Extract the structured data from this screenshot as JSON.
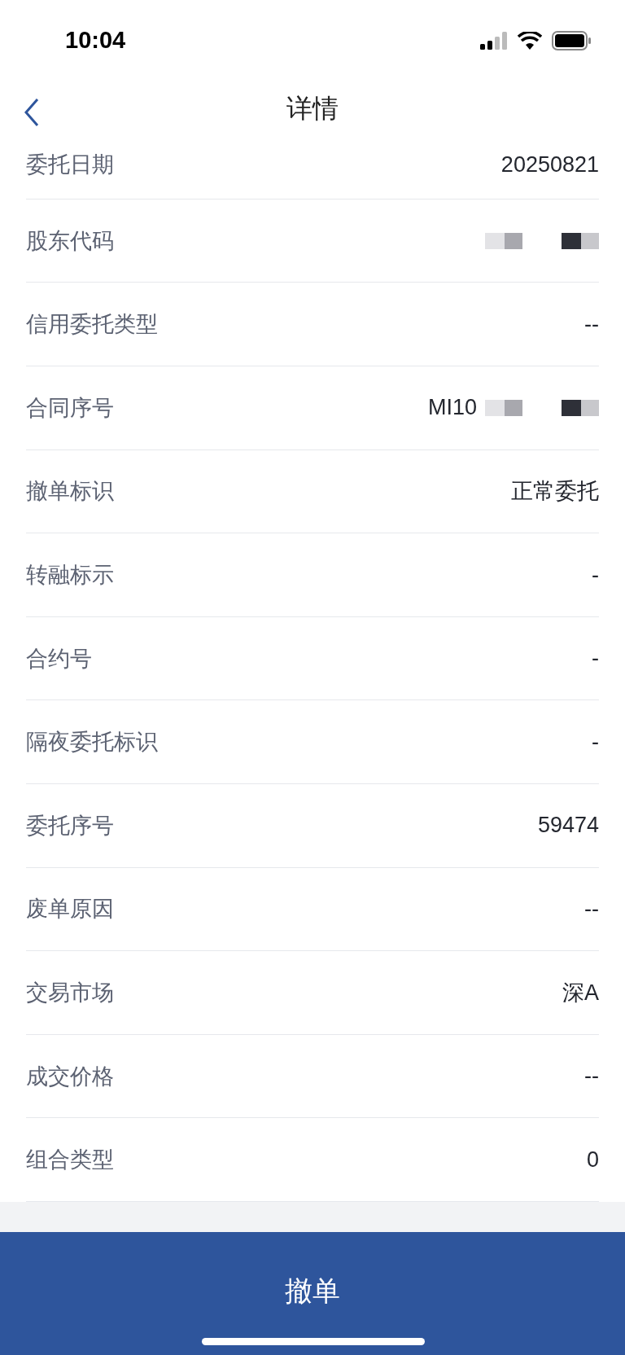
{
  "status_bar": {
    "time": "10:04"
  },
  "nav": {
    "title": "详情"
  },
  "rows": [
    {
      "label": "委托日期",
      "value": "20250821",
      "masked": false
    },
    {
      "label": "股东代码",
      "masked": true
    },
    {
      "label": "信用委托类型",
      "value": "--",
      "masked": false
    },
    {
      "label": "合同序号",
      "value": "MI10",
      "masked": true
    },
    {
      "label": "撤单标识",
      "value": "正常委托",
      "masked": false
    },
    {
      "label": "转融标示",
      "value": "-",
      "masked": false
    },
    {
      "label": "合约号",
      "value": "-",
      "masked": false
    },
    {
      "label": "隔夜委托标识",
      "value": "-",
      "masked": false
    },
    {
      "label": "委托序号",
      "value": "59474",
      "masked": false
    },
    {
      "label": "废单原因",
      "value": "--",
      "masked": false
    },
    {
      "label": "交易市场",
      "value": "深A",
      "masked": false
    },
    {
      "label": "成交价格",
      "value": "--",
      "masked": false
    },
    {
      "label": "组合类型",
      "value": "0",
      "masked": false
    }
  ],
  "action_button": {
    "label": "撤单"
  }
}
